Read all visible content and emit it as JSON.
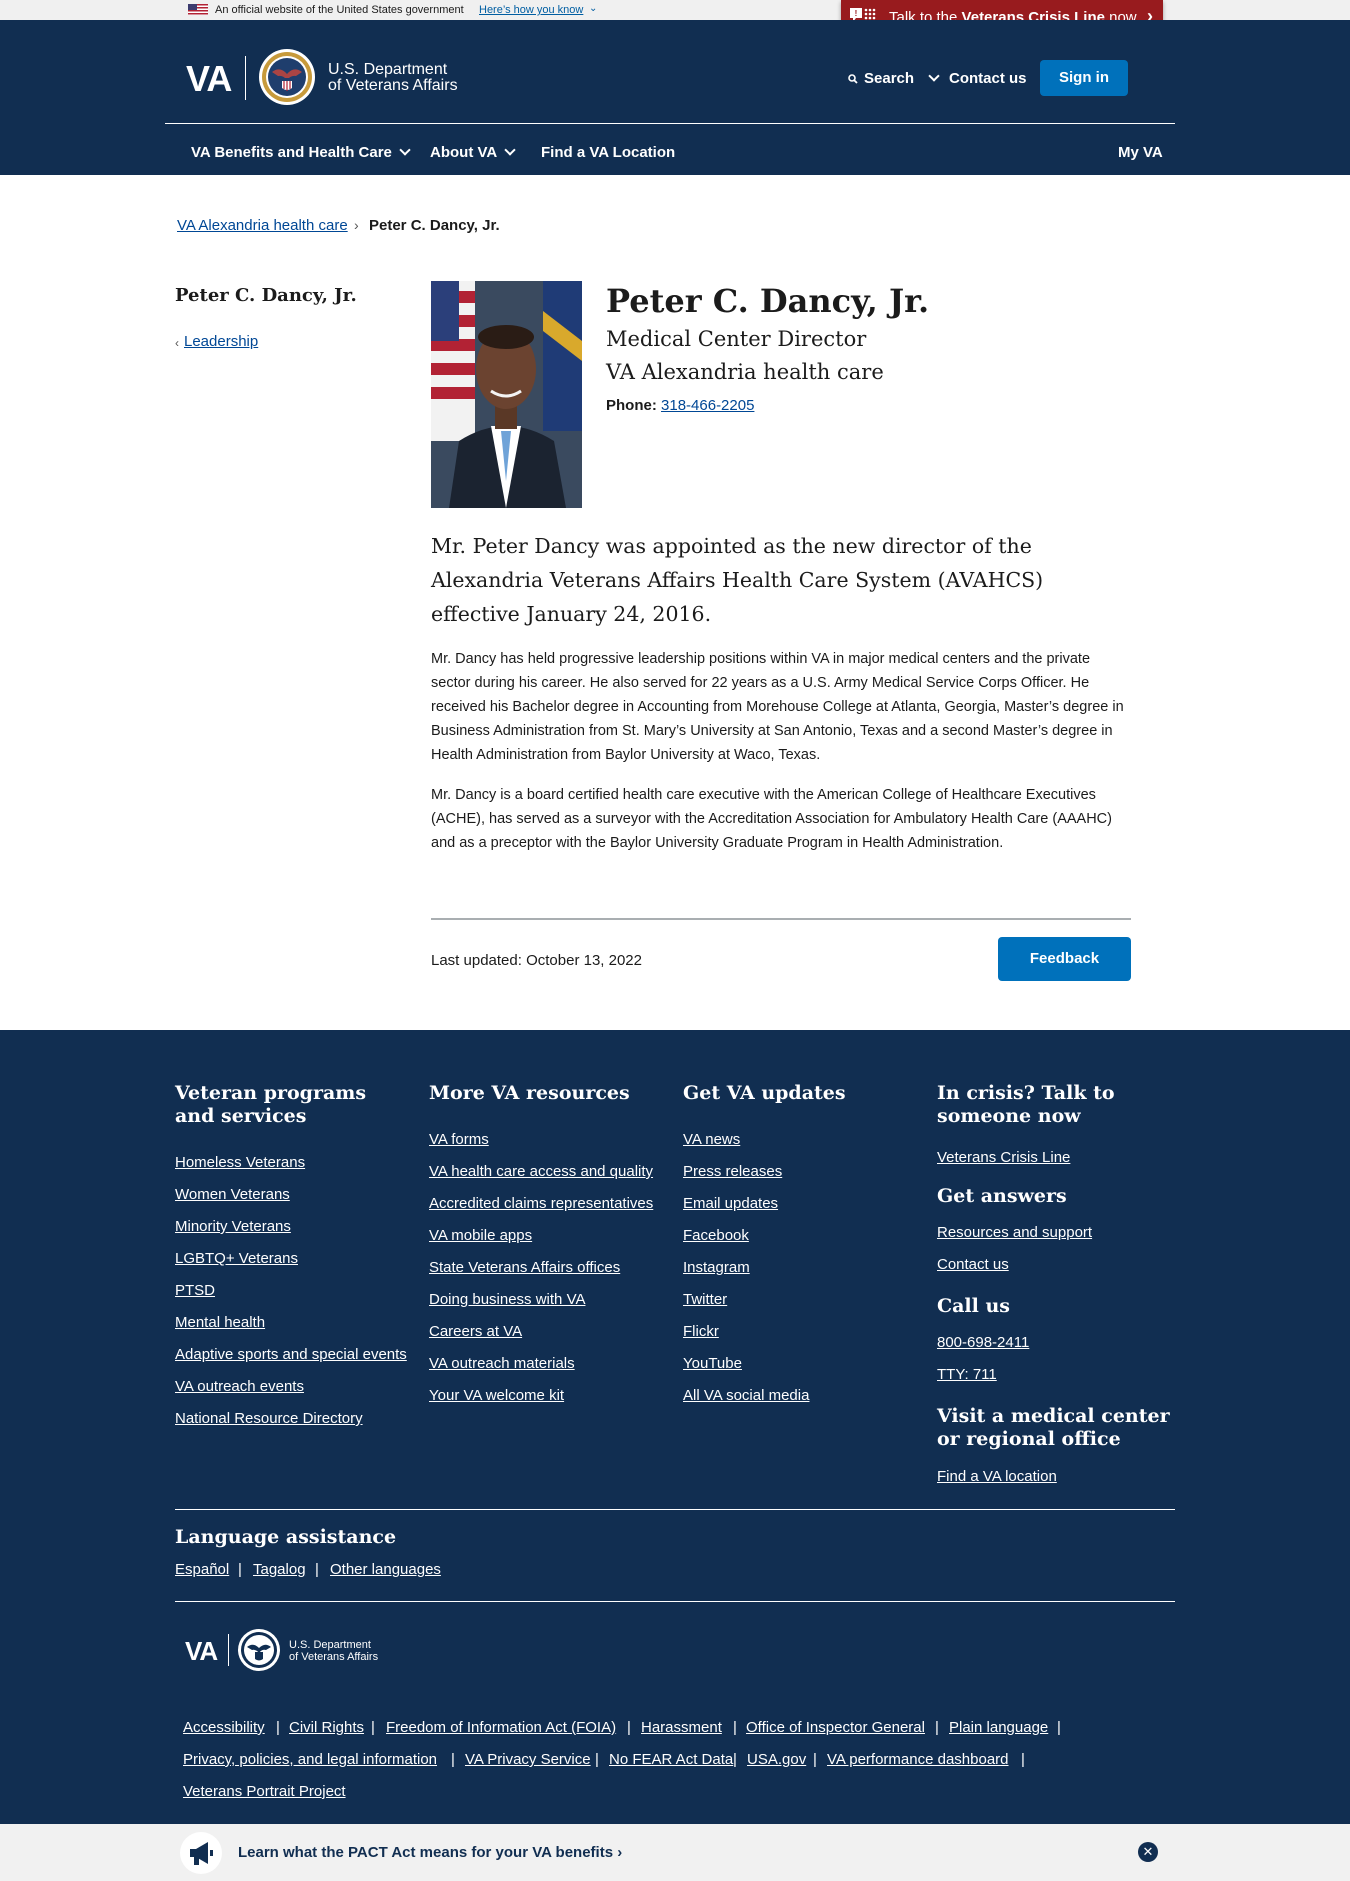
{
  "official_banner": {
    "text": "An official website of the United States government",
    "link": "Here’s how you know"
  },
  "crisis_line": {
    "prefix": "Talk to the ",
    "bold": "Veterans Crisis Line",
    "suffix": " now"
  },
  "header": {
    "logo": "VA",
    "dept_line1": "U.S. Department",
    "dept_line2": "of Veterans Affairs",
    "search": "Search",
    "contact": "Contact us",
    "sign_in": "Sign in",
    "nav": {
      "benefits": "VA Benefits and Health Care",
      "about": "About VA",
      "find": "Find a VA Location",
      "myva": "My VA"
    }
  },
  "breadcrumb": {
    "parent": "VA Alexandria health care",
    "current": "Peter C. Dancy, Jr."
  },
  "sidenav": {
    "title": "Peter C. Dancy, Jr.",
    "back": "Leadership"
  },
  "profile": {
    "name": "Peter C. Dancy, Jr.",
    "title": "Medical Center Director",
    "facility": "VA Alexandria health care",
    "phone_label": "Phone:",
    "phone": "318-466-2205"
  },
  "bio": {
    "lead": "Mr. Peter Dancy was appointed as the new director of the Alexandria Veterans Affairs Health Care System (AVAHCS) effective January 24, 2016.",
    "p1": "Mr. Dancy has held progressive leadership positions within VA in major medical centers and the private sector during his career. He also served for 22 years as a U.S. Army Medical Service Corps Officer. He received his Bachelor degree in Accounting from Morehouse College at Atlanta, Georgia, Master’s degree in Business Administration from St. Mary’s University at San Antonio, Texas and a second Master’s degree in Health Administration from Baylor University at Waco, Texas.",
    "p2": "Mr. Dancy is a board certified health care executive with the American College of Healthcare Executives (ACHE), has served as a surveyor with the Accreditation Association for Ambulatory Health Care (AAAHC) and as a preceptor with the Baylor University Graduate Program in Health Administration."
  },
  "last_updated": "Last updated: October 13, 2022",
  "feedback": "Feedback",
  "footer": {
    "col1": {
      "heading": "Veteran programs and services",
      "links": [
        "Homeless Veterans",
        "Women Veterans",
        "Minority Veterans",
        "LGBTQ+ Veterans",
        "PTSD",
        "Mental health",
        "Adaptive sports and special events",
        "VA outreach events",
        "National Resource Directory"
      ]
    },
    "col2": {
      "heading": "More VA resources",
      "links": [
        "VA forms",
        "VA health care access and quality",
        "Accredited claims representatives",
        "VA mobile apps",
        "State Veterans Affairs offices",
        "Doing business with VA",
        "Careers at VA",
        "VA outreach materials",
        "Your VA welcome kit"
      ]
    },
    "col3": {
      "heading": "Get VA updates",
      "links": [
        "VA news",
        "Press releases",
        "Email updates",
        "Facebook",
        "Instagram",
        "Twitter",
        "Flickr",
        "YouTube",
        "All VA social media"
      ]
    },
    "col4": {
      "crisis_heading": "In crisis? Talk to someone now",
      "crisis_link": "Veterans Crisis Line",
      "answers_heading": "Get answers",
      "answers_links": [
        "Resources and support",
        "Contact us"
      ],
      "call_heading": "Call us",
      "call_links": [
        "800-698-2411",
        "TTY: 711"
      ],
      "visit_heading": "Visit a medical center or regional office",
      "visit_link": "Find a VA location"
    },
    "language": {
      "heading": "Language assistance",
      "links": [
        "Español",
        "Tagalog",
        "Other languages"
      ]
    },
    "bottom_links": [
      "Accessibility",
      "Civil Rights",
      "Freedom of Information Act (FOIA)",
      "Harassment",
      "Office of Inspector General",
      "Plain language",
      "Privacy, policies, and legal information",
      "VA Privacy Service",
      "No FEAR Act Data",
      "USA.gov",
      "VA performance dashboard",
      "Veterans Portrait Project"
    ]
  },
  "pact": {
    "text": "Learn what the PACT Act means for your VA benefits"
  }
}
